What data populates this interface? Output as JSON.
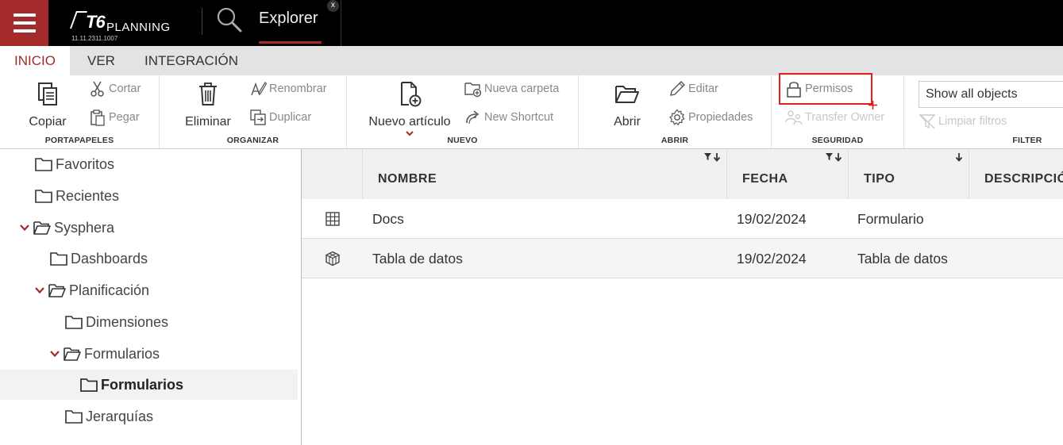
{
  "app": {
    "logo_mark": "T6",
    "logo_name": "PLANNING",
    "version": "11.11.2311.1007",
    "tab_title": "Explorer",
    "tab_close": "x"
  },
  "ribbon_tabs": [
    "INICIO",
    "VER",
    "INTEGRACIÓN"
  ],
  "ribbon": {
    "portapapeles": {
      "label": "PORTAPAPELES",
      "copy": "Copiar",
      "cut": "Cortar",
      "paste": "Pegar"
    },
    "organizar": {
      "label": "ORGANIZAR",
      "delete": "Eliminar",
      "rename": "Renombrar",
      "duplicate": "Duplicar"
    },
    "nuevo": {
      "label": "NUEVO",
      "new_item": "Nuevo artículo",
      "new_folder": "Nueva carpeta",
      "new_shortcut": "New Shortcut"
    },
    "abrir": {
      "label": "ABRIR",
      "open": "Abrir",
      "edit": "Editar",
      "properties": "Propiedades"
    },
    "seguridad": {
      "label": "SEGURIDAD",
      "permissions": "Permisos",
      "transfer_owner": "Transfer Owner"
    },
    "filter": {
      "label": "FILTER",
      "select_value": "Show all objects",
      "clear_filters": "Limpiar filtros"
    }
  },
  "tree": [
    {
      "label": "Favoritos"
    },
    {
      "label": "Recientes"
    },
    {
      "label": "Sysphera"
    },
    {
      "label": "Dashboards"
    },
    {
      "label": "Planificación"
    },
    {
      "label": "Dimensiones"
    },
    {
      "label": "Formularios"
    },
    {
      "label": "Formularios"
    },
    {
      "label": "Jerarquías"
    }
  ],
  "grid": {
    "columns": [
      "NOMBRE",
      "FECHA",
      "TIPO",
      "DESCRIPCIÓN"
    ],
    "rows": [
      {
        "icon": "grid-table-icon",
        "nombre": "Docs",
        "fecha": "19/02/2024",
        "tipo": "Formulario"
      },
      {
        "icon": "cube-icon",
        "nombre": "Tabla de datos",
        "fecha": "19/02/2024",
        "tipo": "Tabla de datos"
      }
    ]
  },
  "colors": {
    "accent": "#a32b2b",
    "highlight_box": "#e02020",
    "topbar": "#000000"
  }
}
